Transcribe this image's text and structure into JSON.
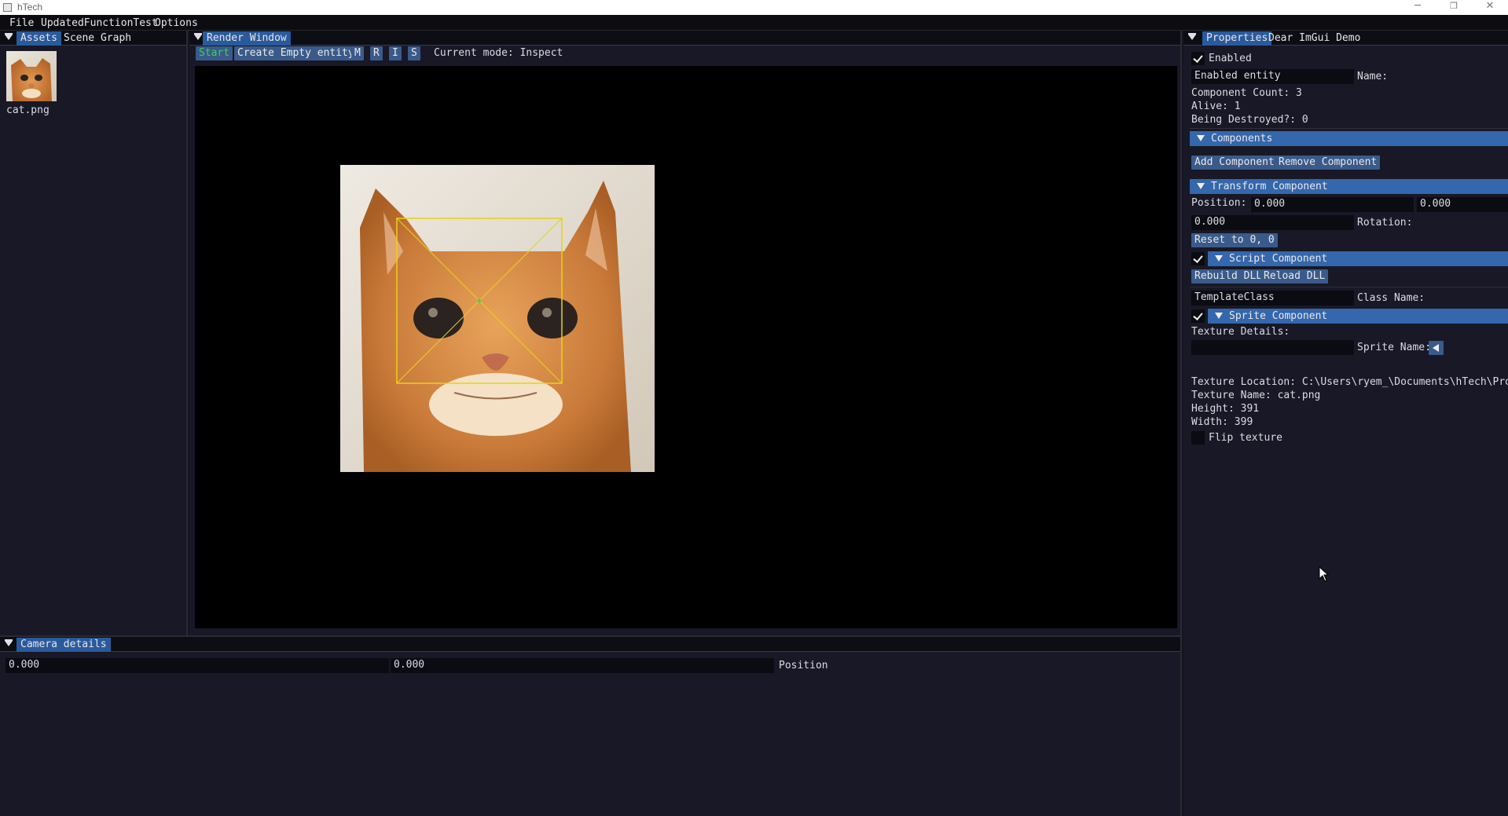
{
  "window": {
    "title": "hTech"
  },
  "menu": [
    "File",
    "UpdatedFunctionTest",
    "Options"
  ],
  "assets_panel": {
    "tabs": [
      "Assets",
      "Scene Graph"
    ],
    "items": [
      {
        "name": "cat.png"
      }
    ]
  },
  "render_window": {
    "tab": "Render Window",
    "toolbar": {
      "start": "Start",
      "create_empty": "Create Empty entity",
      "mode_buttons": [
        "M",
        "R",
        "I",
        "S"
      ],
      "current_mode": "Current mode: Inspect"
    }
  },
  "camera_panel": {
    "tab": "Camera details",
    "position_x": "0.000",
    "position_y": "0.000",
    "position_label": "Position"
  },
  "properties": {
    "tabs": [
      "Properties",
      "Dear ImGui Demo"
    ],
    "enabled_label": "Enabled",
    "name_value": "Enabled entity",
    "name_label": "Name:",
    "component_count": "Component Count: 3",
    "alive": "Alive: 1",
    "being_destroyed": "Being Destroyed?: 0",
    "components_header": "Components",
    "add_component": "Add Component",
    "remove_component": "Remove Component",
    "transform": {
      "header": "Transform Component",
      "position_label": "Position:",
      "pos_x": "0.000",
      "pos_y": "0.000",
      "rotation_value": "0.000",
      "rotation_label": "Rotation:",
      "reset": "Reset to 0, 0"
    },
    "script": {
      "header": "Script Component",
      "rebuild": "Rebuild DLL",
      "reload": "Reload DLL",
      "class_value": "TemplateClass",
      "class_label": "Class Name:"
    },
    "sprite": {
      "header": "Sprite Component",
      "texture_details": "Texture Details:",
      "sprite_name_value": "",
      "sprite_name_label": "Sprite Name:",
      "texture_location": "Texture Location: C:\\Users\\ryem_\\Documents\\hTech\\Projects\\",
      "texture_name": "Texture Name: cat.png",
      "height": "Height: 391",
      "width": "Width: 399",
      "flip_label": "Flip texture"
    }
  },
  "colors": {
    "panel_bg": "#181826",
    "accent": "#2a5a9c",
    "header": "#3467ab",
    "button": "#3a5b8a",
    "start_text": "#3fcf5a",
    "gizmo": "#e6d21a"
  },
  "icons": [
    "app-icon",
    "minimize-icon",
    "maximize-icon",
    "close-icon",
    "collapse-arrow-icon",
    "checkmark-icon",
    "arrow-left-icon",
    "mouse-cursor-icon"
  ]
}
